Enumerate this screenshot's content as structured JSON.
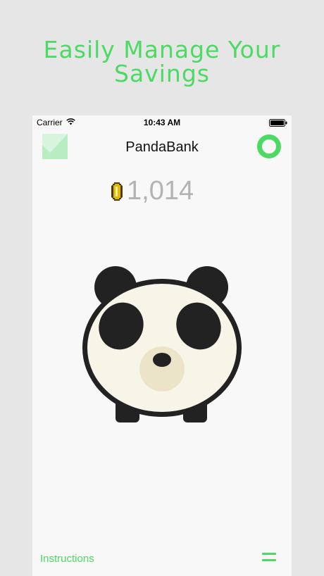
{
  "headline": {
    "line1": "Easily Manage Your",
    "line2": "Savings"
  },
  "status_bar": {
    "carrier": "Carrier",
    "time": "10:43 AM"
  },
  "nav": {
    "title": "PandaBank"
  },
  "balance": {
    "value": "1,014"
  },
  "footer": {
    "instructions_label": "Instructions"
  },
  "colors": {
    "accent": "#4cd964",
    "background": "#e6e6e6",
    "screen": "#f8f8f8"
  },
  "icons": [
    "wifi-icon",
    "battery-icon",
    "check-icon",
    "ring-icon",
    "coin-icon",
    "panda-icon",
    "menu-icon"
  ]
}
